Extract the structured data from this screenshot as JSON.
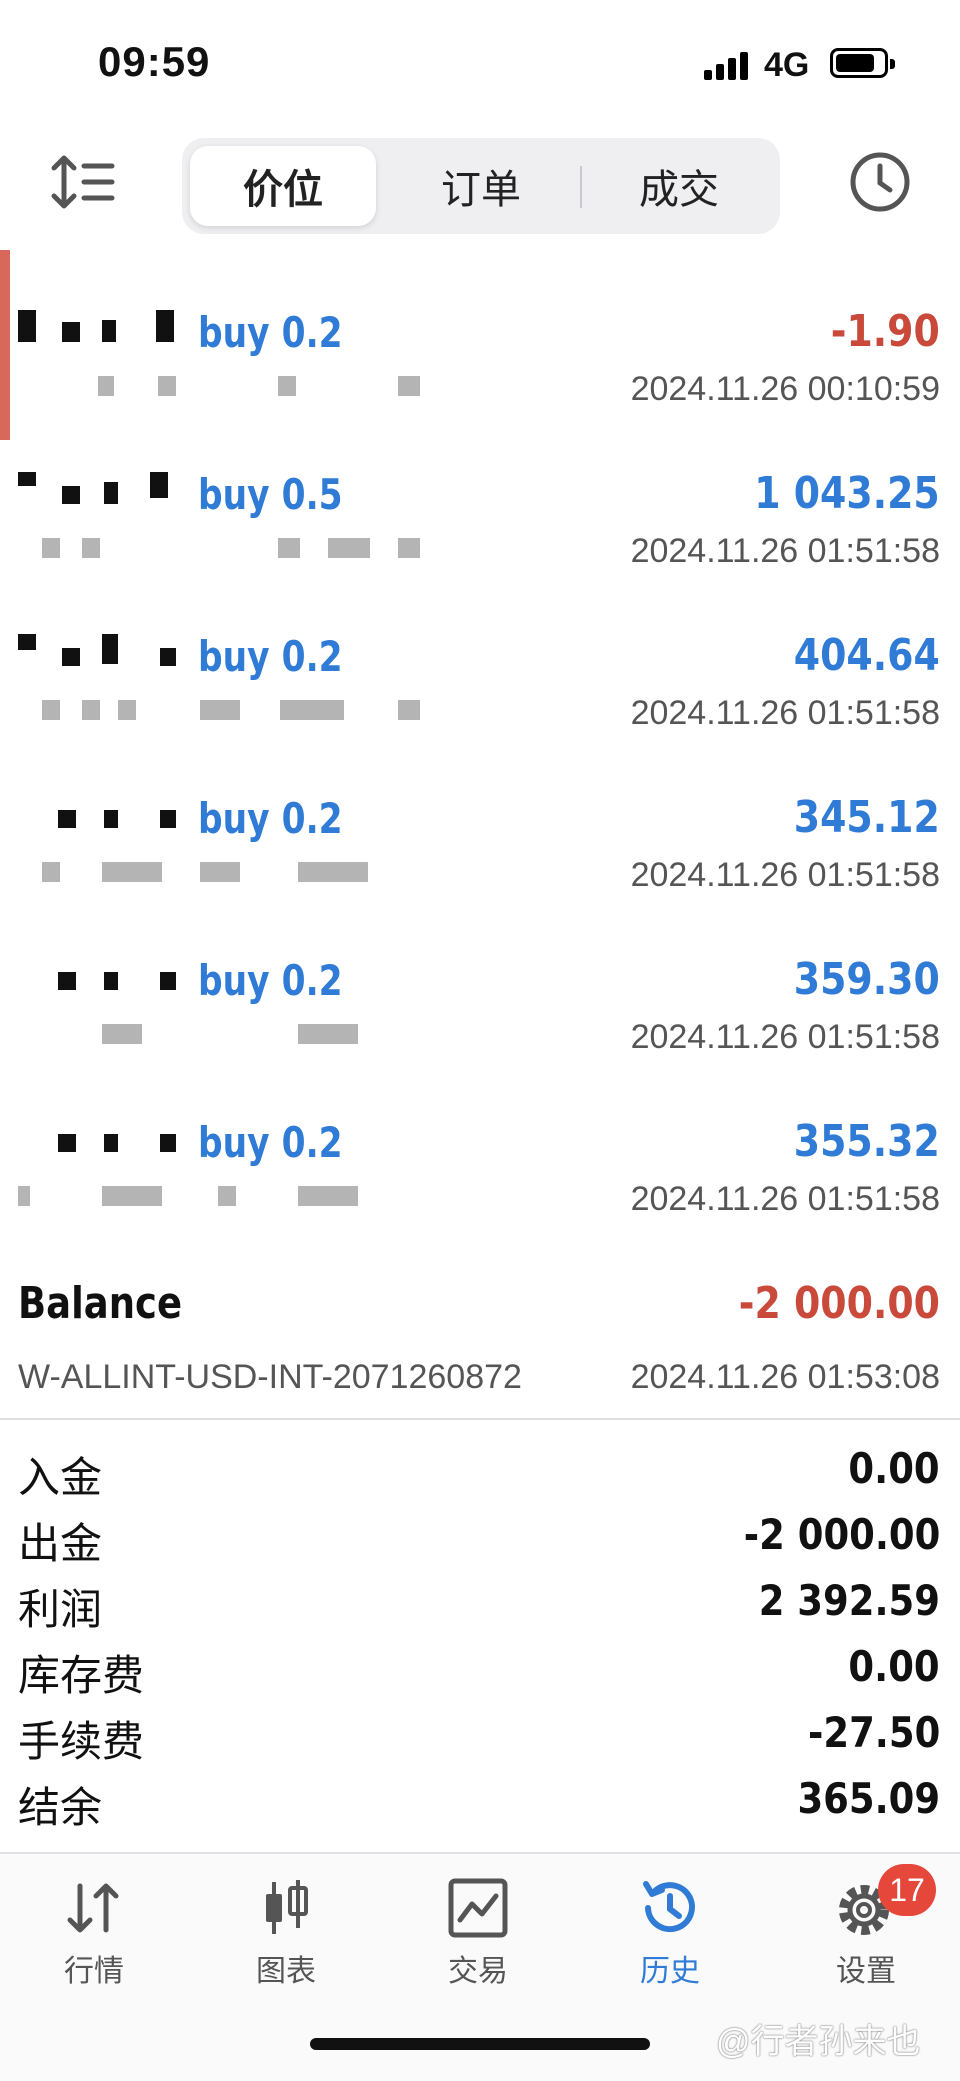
{
  "status_bar": {
    "time": "09:59",
    "network": "4G"
  },
  "toolbar": {
    "tabs": [
      {
        "label": "价位"
      },
      {
        "label": "订单"
      },
      {
        "label": "成交"
      }
    ]
  },
  "deals": [
    {
      "type": "buy 0.2",
      "profit": "-1.90",
      "date": "2024.11.26 00:10:59"
    },
    {
      "type": "buy 0.5",
      "profit": "1 043.25",
      "date": "2024.11.26 01:51:58"
    },
    {
      "type": "buy 0.2",
      "profit": "404.64",
      "date": "2024.11.26 01:51:58"
    },
    {
      "type": "buy 0.2",
      "profit": "345.12",
      "date": "2024.11.26 01:51:58"
    },
    {
      "type": "buy 0.2",
      "profit": "359.30",
      "date": "2024.11.26 01:51:58"
    },
    {
      "type": "buy 0.2",
      "profit": "355.32",
      "date": "2024.11.26 01:51:58"
    }
  ],
  "balance": {
    "label": "Balance",
    "amount": "-2 000.00",
    "comment": "W-ALLINT-USD-INT-2071260872",
    "date": "2024.11.26 01:53:08"
  },
  "summary": [
    {
      "label": "入金",
      "value": "0.00"
    },
    {
      "label": "出金",
      "value": "-2 000.00"
    },
    {
      "label": "利润",
      "value": "2 392.59"
    },
    {
      "label": "库存费",
      "value": "0.00"
    },
    {
      "label": "手续费",
      "value": "-27.50"
    },
    {
      "label": "结余",
      "value": "365.09"
    }
  ],
  "nav": {
    "items": [
      {
        "label": "行情",
        "icon": "quotes-icon"
      },
      {
        "label": "图表",
        "icon": "chart-icon"
      },
      {
        "label": "交易",
        "icon": "trade-icon"
      },
      {
        "label": "历史",
        "icon": "history-icon"
      },
      {
        "label": "设置",
        "icon": "settings-icon"
      }
    ],
    "settings_badge": "17"
  },
  "watermark": "@行者孙来也",
  "colors": {
    "accent": "#2f7bd6",
    "negative": "#c94a3a",
    "badge": "#e5473b"
  }
}
